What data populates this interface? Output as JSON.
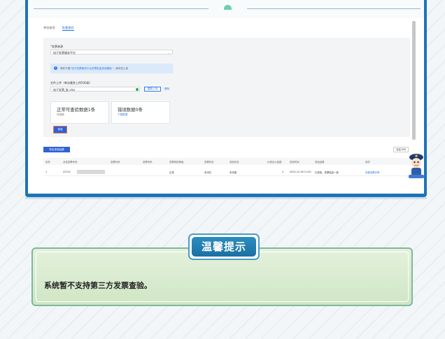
{
  "tabs": [
    {
      "label": "单张查验",
      "active": false
    },
    {
      "label": "批量查验",
      "active": true
    }
  ],
  "form": {
    "source_label": "发票来源",
    "source_value": "电子发票服务平台",
    "info_text_prefix": "请先下载",
    "info_link": "“电子发票服务平台发票批量查验模板”",
    "info_text_suffix": "，填写完上传",
    "upload_label": "文件上传（单次最多上传500条）",
    "file_name": "电子发票_批.xlsx",
    "reupload_label": "重新上传",
    "delete_label": "删除"
  },
  "cards": [
    {
      "big": "正常可查验数据1条",
      "sub": "可查验",
      "sub_is_link": false
    },
    {
      "big": "错误数据0条",
      "sub": "下载数据",
      "sub_is_link": true
    }
  ],
  "query_button": "查验",
  "export_button": "导出查验结果",
  "column_button": "自定义列",
  "table": {
    "headers": [
      "序号",
      "全电发票号码",
      "发票代码",
      "发票号码",
      "发票风险等级",
      "发票状态",
      "查验状态",
      "价税合计金额",
      "查验时间",
      "查验结果",
      "操作"
    ],
    "row": {
      "index": "1",
      "number": "22122",
      "risk": "正常",
      "invoice_status": "未冲红",
      "check_status": "未作废",
      "amount": "2",
      "time": "2022-12-18 11:20",
      "result": "已查验，发票信息一致",
      "action": "查看电票详情"
    }
  },
  "tip": {
    "title": "温馨提示",
    "text": "系统暂不支持第三方发票查验。"
  }
}
